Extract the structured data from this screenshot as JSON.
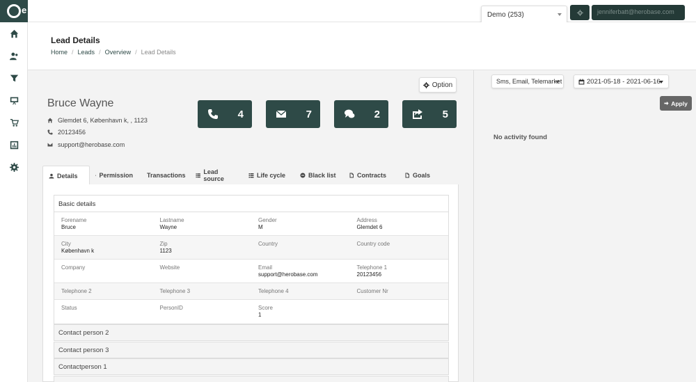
{
  "app": {
    "logo_letter": "e"
  },
  "topbar": {
    "campaign_select": "Demo (253)",
    "user_email": "jenniferbatt@herobase.com"
  },
  "header": {
    "title": "Lead Details",
    "breadcrumb": [
      "Home",
      "Leads",
      "Overview",
      "Lead Details"
    ]
  },
  "lead": {
    "name": "Bruce Wayne",
    "address": "Glemdet 6, København k, , 1123",
    "phone": "20123456",
    "email": "support@herobase.com"
  },
  "option_label": "Option",
  "stats": [
    {
      "icon": "phone-icon",
      "count": "4"
    },
    {
      "icon": "envelope-icon",
      "count": "7"
    },
    {
      "icon": "comments-icon",
      "count": "2"
    },
    {
      "icon": "share-icon",
      "count": "5"
    }
  ],
  "tabs": [
    {
      "label": "Details",
      "icon": "user-icon"
    },
    {
      "label": "Permission",
      "icon": "lock-icon"
    },
    {
      "label": "Transactions",
      "icon": "database-icon"
    },
    {
      "label": "Lead source",
      "icon": "list-icon"
    },
    {
      "label": "Life cycle",
      "icon": "list-icon"
    },
    {
      "label": "Black list",
      "icon": "minus-circle-icon"
    },
    {
      "label": "Contracts",
      "icon": "file-icon"
    },
    {
      "label": "Goals",
      "icon": "file-icon"
    }
  ],
  "basic_details": {
    "heading": "Basic details",
    "rows": [
      [
        {
          "label": "Forename",
          "value": "Bruce"
        },
        {
          "label": "Lastname",
          "value": "Wayne"
        },
        {
          "label": "Gender",
          "value": "M"
        },
        {
          "label": "Address",
          "value": "Glemdet 6"
        }
      ],
      [
        {
          "label": "City",
          "value": "København k"
        },
        {
          "label": "Zip",
          "value": "1123"
        },
        {
          "label": "Country",
          "value": ""
        },
        {
          "label": "Country code",
          "value": ""
        }
      ],
      [
        {
          "label": "Company",
          "value": ""
        },
        {
          "label": "Website",
          "value": ""
        },
        {
          "label": "Email",
          "value": "support@herobase.com"
        },
        {
          "label": "Telephone 1",
          "value": "20123456"
        }
      ],
      [
        {
          "label": "Telephone 2",
          "value": ""
        },
        {
          "label": "Telephone 3",
          "value": ""
        },
        {
          "label": "Telephone 4",
          "value": ""
        },
        {
          "label": "Customer Nr",
          "value": ""
        }
      ],
      [
        {
          "label": "Status",
          "value": ""
        },
        {
          "label": "PersonID",
          "value": ""
        },
        {
          "label": "Score",
          "value": "1"
        },
        {
          "label": "",
          "value": ""
        }
      ]
    ]
  },
  "collapsed_panels": [
    "Contact person 2",
    "Contact person 3",
    "Contactperson 1"
  ],
  "activity": {
    "channel_select": "Sms, Email, Telemarket",
    "date_range": "2021-05-18 - 2021-06-16",
    "apply_label": "Apply",
    "empty_text": "No activity found"
  }
}
